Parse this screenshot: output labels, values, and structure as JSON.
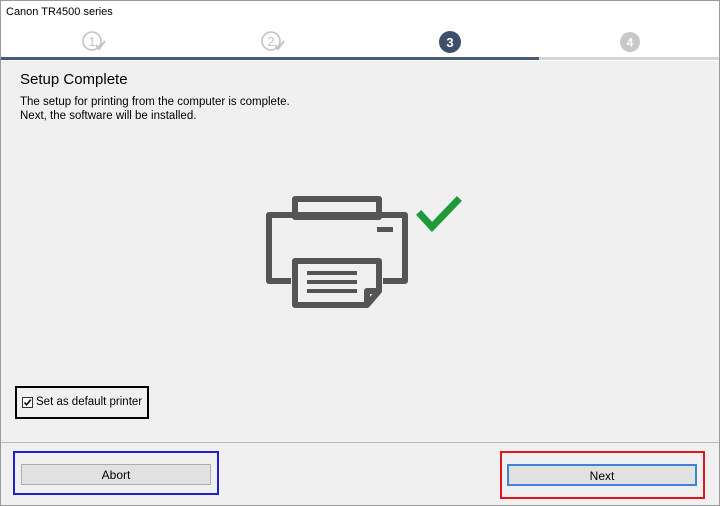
{
  "window": {
    "title": "Canon TR4500 series"
  },
  "steps": [
    {
      "number": "1",
      "state": "completed"
    },
    {
      "number": "2",
      "state": "completed"
    },
    {
      "number": "3",
      "state": "current"
    },
    {
      "number": "4",
      "state": "upcoming"
    }
  ],
  "progress": {
    "current_step": 3,
    "total_steps": 4
  },
  "main": {
    "heading": "Setup Complete",
    "description_line1": "The setup for printing from the computer is complete.",
    "description_line2": "Next, the software will be installed.",
    "illustration_icons": [
      "printer-icon",
      "checkmark-icon"
    ]
  },
  "options": {
    "default_printer_label": "Set as default printer",
    "default_printer_checked": true
  },
  "buttons": {
    "abort_label": "Abort",
    "next_label": "Next"
  },
  "colors": {
    "current_step": "#3e4f6a",
    "inactive_step": "#c8c8c8",
    "progress_fill": "#4a5c74",
    "check_green": "#1f9a3a",
    "printer_gray": "#555555"
  }
}
